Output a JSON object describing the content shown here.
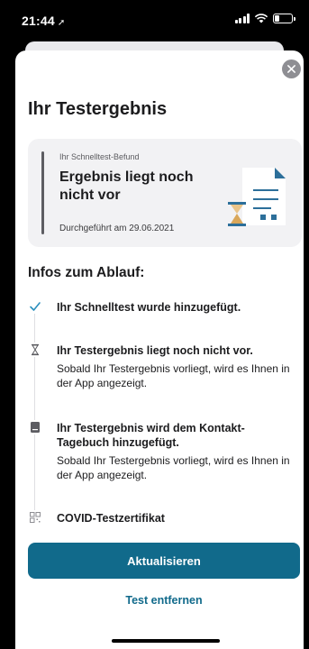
{
  "status_bar": {
    "time": "21:44",
    "location_icon": "location-arrow-icon",
    "signal_icon": "cellular-signal-icon",
    "wifi_icon": "wifi-icon",
    "battery_icon": "battery-icon",
    "battery_level": 0.3
  },
  "sheet": {
    "close_icon": "close-icon",
    "title": "Ihr Testergebnis"
  },
  "result_card": {
    "label": "Ihr Schnelltest-Befund",
    "result": "Ergebnis liegt noch nicht vor",
    "performed": "Durchgeführt am 29.06.2021",
    "illustration": "document-hourglass-illustration"
  },
  "steps": {
    "heading": "Infos zum Ablauf:",
    "items": [
      {
        "icon": "checkmark-icon",
        "title": "Ihr Schnelltest wurde hinzugefügt.",
        "description": ""
      },
      {
        "icon": "hourglass-icon",
        "title": "Ihr Testergebnis liegt noch nicht vor.",
        "description": "Sobald Ihr Testergebnis vorliegt, wird es Ihnen in der App angezeigt."
      },
      {
        "icon": "book-icon",
        "title": "Ihr Testergebnis wird dem Kontakt-Tagebuch hinzugefügt.",
        "description": "Sobald Ihr Testergebnis vorliegt, wird es Ihnen in der App angezeigt."
      },
      {
        "icon": "qr-code-icon",
        "title": "COVID-Testzertifikat",
        "description": ""
      }
    ]
  },
  "actions": {
    "refresh": "Aktualisieren",
    "remove": "Test entfernen"
  },
  "colors": {
    "primary": "#116a8b",
    "check": "#2a8fbd",
    "card_background": "#f2f2f4",
    "illustration_blue": "#2c6f9a"
  }
}
